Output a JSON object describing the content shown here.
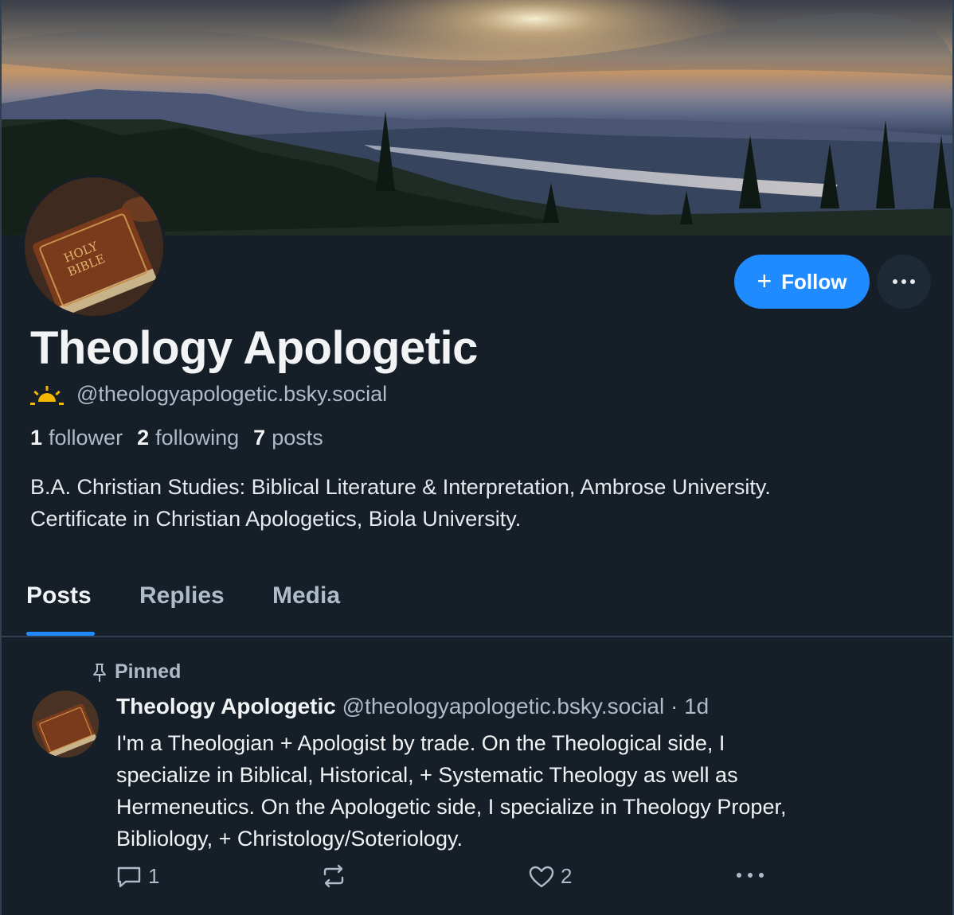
{
  "profile": {
    "display_name": "Theology Apologetic",
    "handle": "@theologyapologetic.bsky.social",
    "followers_count": "1",
    "followers_label": "follower",
    "following_count": "2",
    "following_label": "following",
    "posts_count": "7",
    "posts_label": "posts",
    "bio_line1": "B.A. Christian Studies: Biblical Literature & Interpretation, Ambrose University.",
    "bio_line2": "Certificate in Christian Apologetics, Biola University."
  },
  "actions": {
    "follow_label": "Follow"
  },
  "tabs": [
    {
      "label": "Posts",
      "active": true
    },
    {
      "label": "Replies",
      "active": false
    },
    {
      "label": "Media",
      "active": false
    }
  ],
  "post": {
    "pinned_label": "Pinned",
    "author": "Theology Apologetic",
    "handle": "@theologyapologetic.bsky.social",
    "time": "· 1d",
    "text_lines": [
      "I'm a Theologian +  Apologist by trade. On the Theological side, I",
      "specialize in Biblical, Historical, + Systematic Theology as well as",
      "Hermeneutics. On the Apologetic side, I specialize in Theology Proper,",
      "Bibliology, + Christology/Soteriology."
    ],
    "reply_count": "1",
    "like_count": "2"
  },
  "colors": {
    "background": "#161e27",
    "accent": "#208bfe",
    "muted_text": "#aebbc9",
    "sun_badge": "#f5b800"
  }
}
